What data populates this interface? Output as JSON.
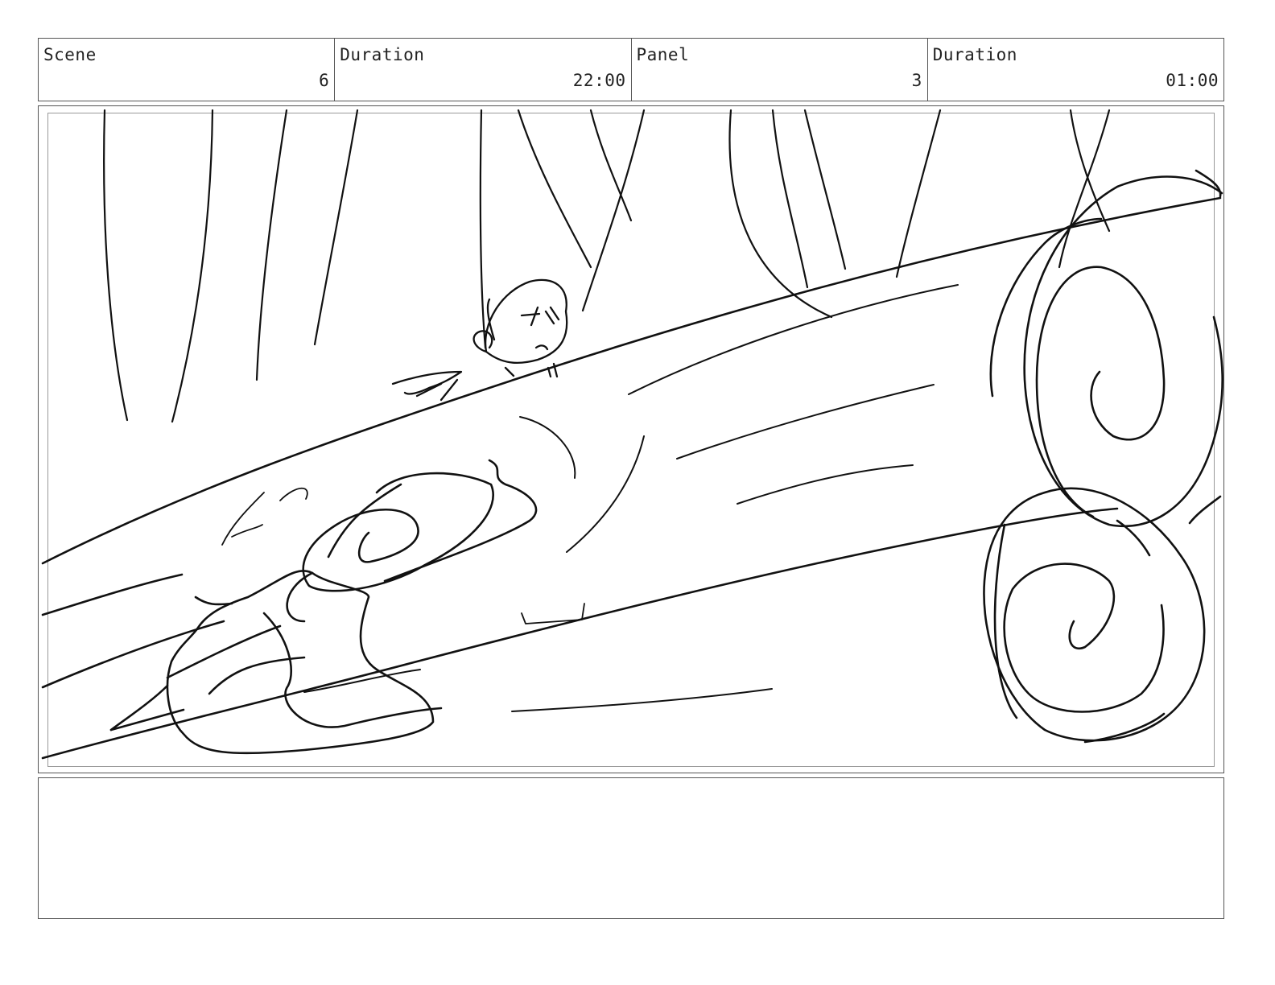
{
  "header": {
    "scene_label": "Scene",
    "scene_value": "6",
    "scene_duration_label": "Duration",
    "scene_duration_value": "22:00",
    "panel_label": "Panel",
    "panel_value": "3",
    "panel_duration_label": "Duration",
    "panel_duration_value": "01:00"
  },
  "notes": {
    "text": ""
  }
}
